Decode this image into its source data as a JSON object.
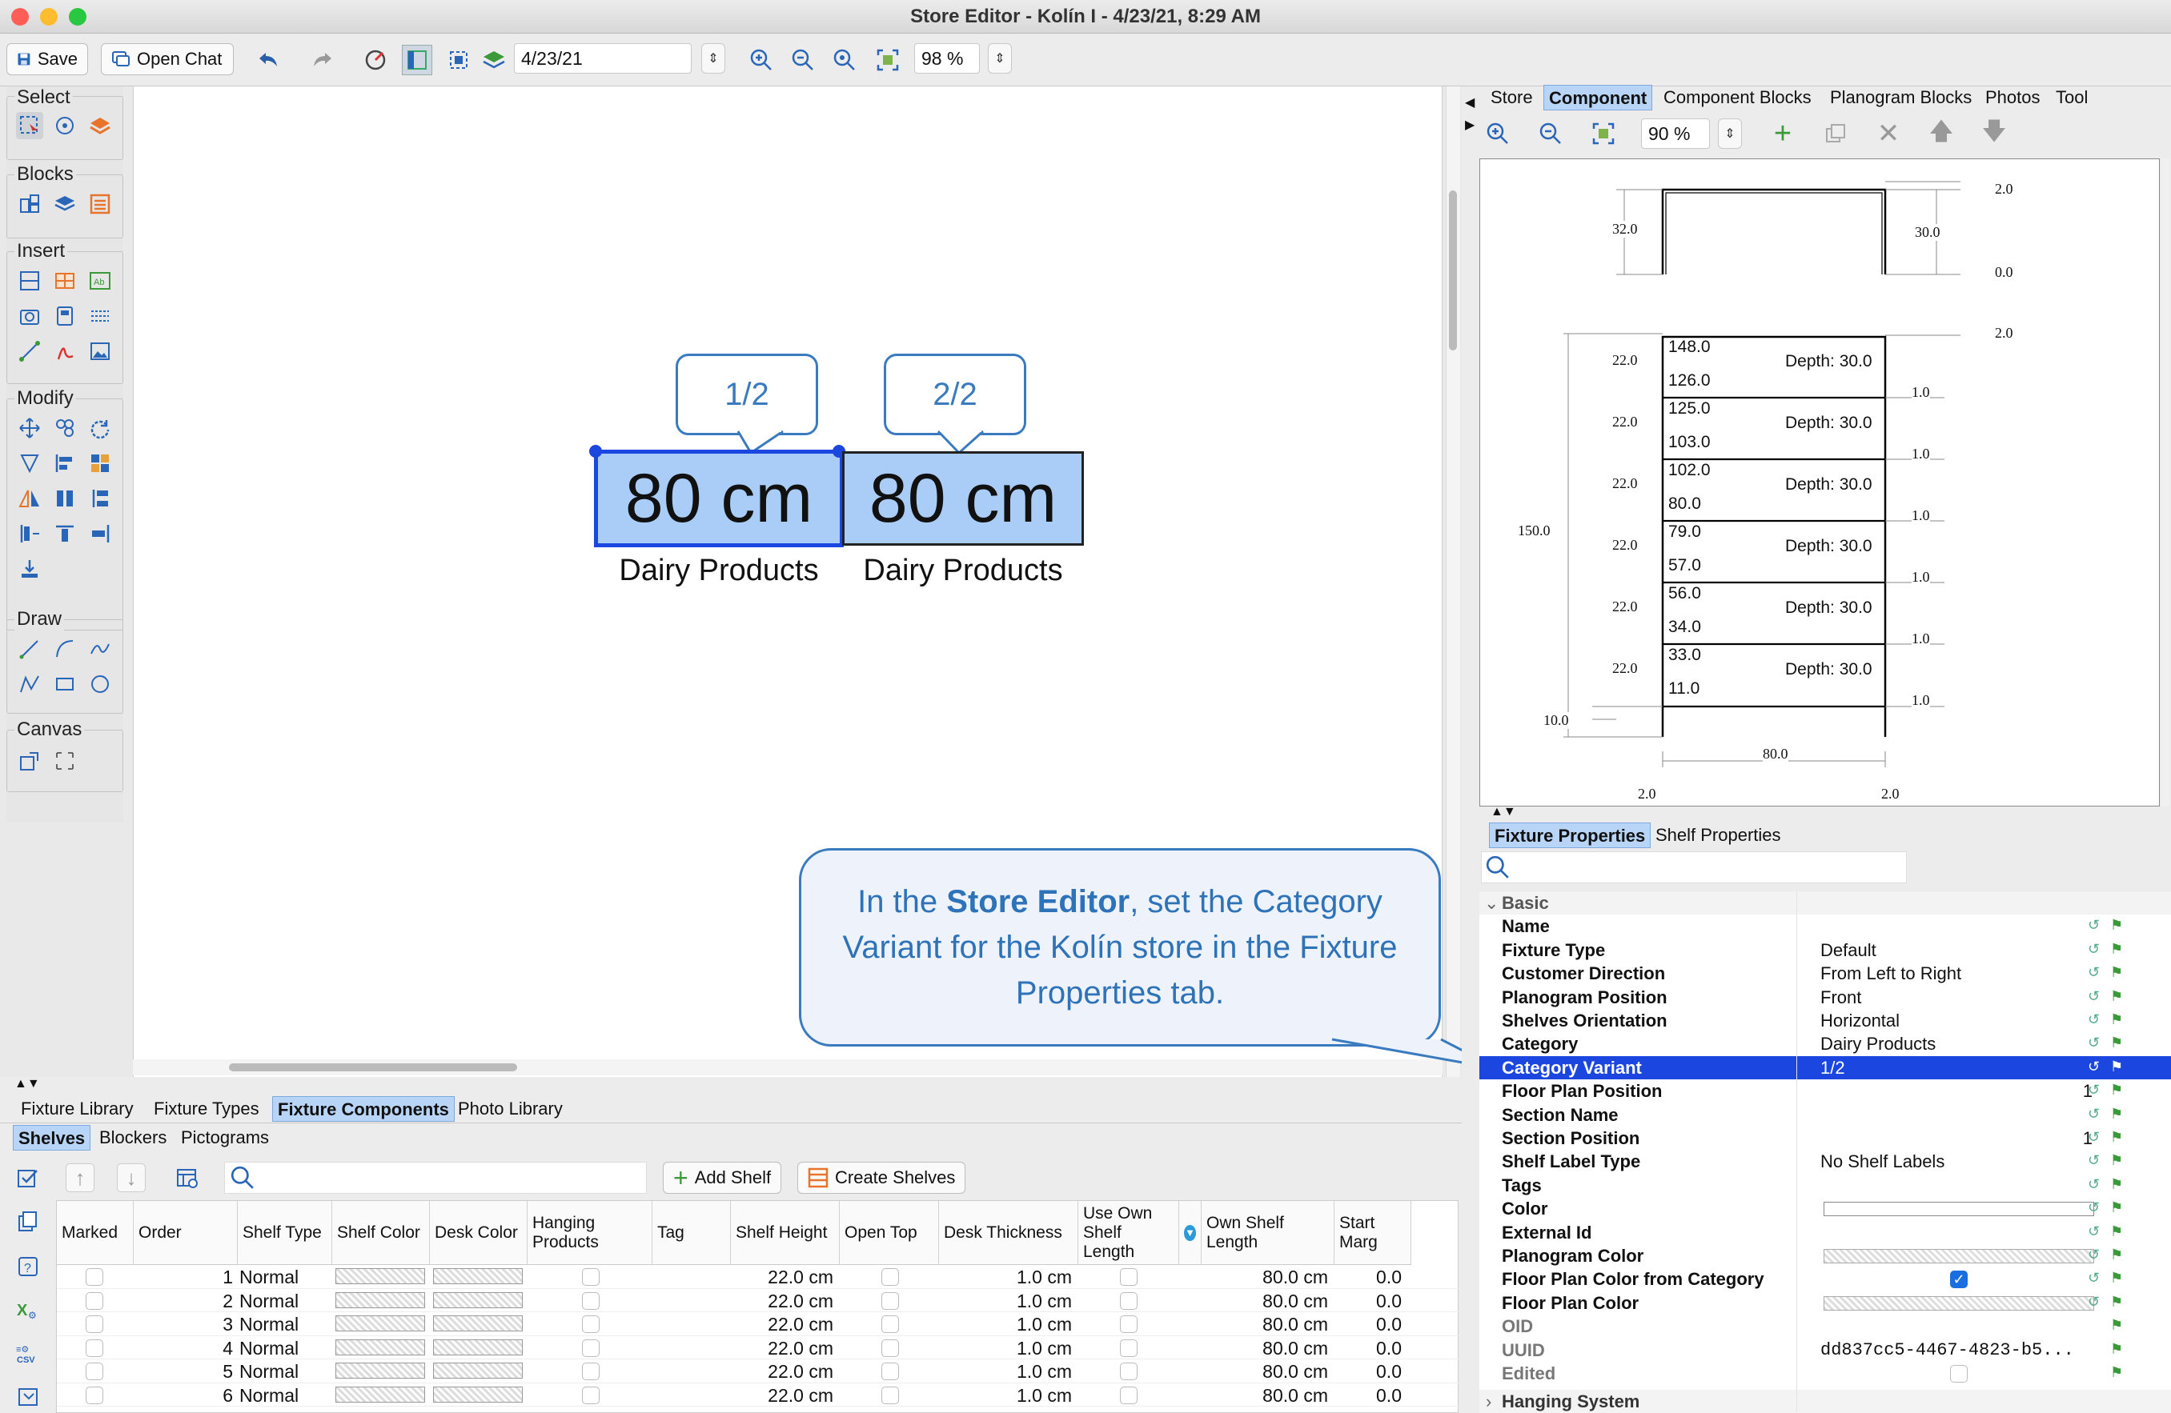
{
  "window": {
    "title": "Store Editor - Kolín I - 4/23/21, 8:29 AM"
  },
  "toolbar": {
    "save_label": "Save",
    "open_chat_label": "Open Chat",
    "date_value": "4/23/21",
    "zoom_value": "98 %"
  },
  "palette": {
    "select_label": "Select",
    "blocks_label": "Blocks",
    "insert_label": "Insert",
    "modify_label": "Modify",
    "draw_label": "Draw",
    "canvas_label": "Canvas"
  },
  "canvas": {
    "shelves": [
      {
        "tag": "1/2",
        "width_label": "80 cm",
        "category": "Dairy Products"
      },
      {
        "tag": "2/2",
        "width_label": "80 cm",
        "category": "Dairy Products"
      }
    ],
    "instruction": {
      "prefix": "In the ",
      "bold": "Store Editor",
      "suffix": ", set the Category Variant for the Kolín store in the Fixture Properties tab."
    }
  },
  "right_tabs": [
    "Store",
    "Component",
    "Component Blocks",
    "Planogram Blocks",
    "Photos",
    "Tool"
  ],
  "right_tabs_selected": "Component",
  "component_toolbar": {
    "zoom_value": "90 %"
  },
  "diagram": {
    "top_labels": {
      "left": "32.0",
      "right_top": "2.0",
      "right_mid": "30.0",
      "right_bot": "0.0"
    },
    "right_top2": "2.0",
    "total_height": "150.0",
    "shelves": [
      {
        "top": "148.0",
        "bottom": "126.0",
        "depth": "Depth: 30.0",
        "gap": "22.0",
        "thick": "1.0"
      },
      {
        "top": "125.0",
        "bottom": "103.0",
        "depth": "Depth: 30.0",
        "gap": "22.0",
        "thick": "1.0"
      },
      {
        "top": "102.0",
        "bottom": "80.0",
        "depth": "Depth: 30.0",
        "gap": "22.0",
        "thick": "1.0"
      },
      {
        "top": "79.0",
        "bottom": "57.0",
        "depth": "Depth: 30.0",
        "gap": "22.0",
        "thick": "1.0"
      },
      {
        "top": "56.0",
        "bottom": "34.0",
        "depth": "Depth: 30.0",
        "gap": "22.0",
        "thick": "1.0"
      },
      {
        "top": "33.0",
        "bottom": "11.0",
        "depth": "Depth: 30.0",
        "gap": "22.0",
        "thick": "1.0"
      }
    ],
    "base": "10.0",
    "width": "80.0",
    "side_left": "2.0",
    "side_right": "2.0"
  },
  "prop_tabs": [
    "Fixture Properties",
    "Shelf Properties"
  ],
  "properties": {
    "section_basic": "Basic",
    "section_hanging": "Hanging System",
    "rows": [
      {
        "name": "Name",
        "value": ""
      },
      {
        "name": "Fixture Type",
        "value": "Default"
      },
      {
        "name": "Customer Direction",
        "value": "From Left to Right"
      },
      {
        "name": "Planogram Position",
        "value": "Front"
      },
      {
        "name": "Shelves Orientation",
        "value": "Horizontal"
      },
      {
        "name": "Category",
        "value": "Dairy Products"
      },
      {
        "name": "Category Variant",
        "value": "1/2"
      },
      {
        "name": "Floor Plan Position",
        "value": "1"
      },
      {
        "name": "Section Name",
        "value": ""
      },
      {
        "name": "Section Position",
        "value": "1"
      },
      {
        "name": "Shelf Label Type",
        "value": "No Shelf Labels"
      },
      {
        "name": "Tags",
        "value": ""
      },
      {
        "name": "Color",
        "value": ""
      },
      {
        "name": "External Id",
        "value": ""
      },
      {
        "name": "Planogram Color",
        "value": ""
      },
      {
        "name": "Floor Plan Color from Category",
        "value": ""
      },
      {
        "name": "Floor Plan Color",
        "value": ""
      },
      {
        "name": "OID",
        "value": ""
      },
      {
        "name": "UUID",
        "value": "dd837cc5-4467-4823-b5..."
      },
      {
        "name": "Edited",
        "value": ""
      }
    ]
  },
  "bottom_tabs": [
    "Fixture Library",
    "Fixture Types",
    "Fixture Components",
    "Photo Library"
  ],
  "bottom_tabs_selected": "Fixture Components",
  "sub_tabs": [
    "Shelves",
    "Blockers",
    "Pictograms"
  ],
  "sub_tabs_selected": "Shelves",
  "shelf_toolbar": {
    "add_shelf": "Add Shelf",
    "create_shelves": "Create Shelves"
  },
  "table": {
    "headers": [
      "Marked",
      "Order",
      "Shelf Type",
      "Shelf Color",
      "Desk Color",
      "Hanging Products",
      "Tag",
      "Shelf Height",
      "Open Top",
      "Desk Thickness",
      "Use Own Shelf Length",
      "",
      "Own Shelf Length",
      "Start Marg"
    ],
    "rows": [
      {
        "order": "1",
        "type": "Normal",
        "height": "22.0 cm",
        "thick": "1.0 cm",
        "length": "80.0 cm",
        "start": "0.0"
      },
      {
        "order": "2",
        "type": "Normal",
        "height": "22.0 cm",
        "thick": "1.0 cm",
        "length": "80.0 cm",
        "start": "0.0"
      },
      {
        "order": "3",
        "type": "Normal",
        "height": "22.0 cm",
        "thick": "1.0 cm",
        "length": "80.0 cm",
        "start": "0.0"
      },
      {
        "order": "4",
        "type": "Normal",
        "height": "22.0 cm",
        "thick": "1.0 cm",
        "length": "80.0 cm",
        "start": "0.0"
      },
      {
        "order": "5",
        "type": "Normal",
        "height": "22.0 cm",
        "thick": "1.0 cm",
        "length": "80.0 cm",
        "start": "0.0"
      },
      {
        "order": "6",
        "type": "Normal",
        "height": "22.0 cm",
        "thick": "1.0 cm",
        "length": "80.0 cm",
        "start": "0.0"
      }
    ]
  },
  "colors": {
    "accent": "#1c46e0",
    "callout": "#3a7bbf",
    "shelf_fill": "#a9cdf6",
    "tab_selected": "#b8d5f7"
  }
}
